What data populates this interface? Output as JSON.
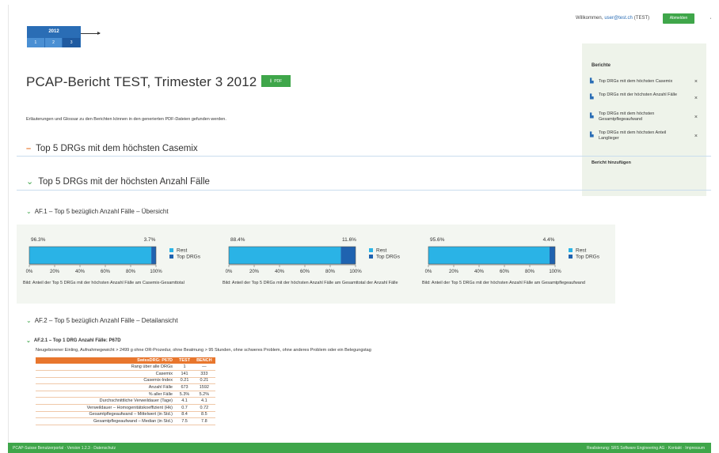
{
  "header": {
    "year": "2012",
    "trimesters": [
      "1",
      "2",
      "3"
    ],
    "welcome_prefix": "Willkommen,",
    "user_email": "user@test.ch",
    "user_suffix": "(TEST)",
    "logout_label": "Abmelden"
  },
  "page": {
    "title": "PCAP-Bericht TEST, Trimester 3 2012",
    "pdf_label": "PDF",
    "intro": "Erläuterungen und Glossar zu den Berichten können in den generierten PDF-Dateien gefunden werden."
  },
  "reports_panel": {
    "title": "Berichte",
    "items": [
      "Top DRGs mit dem höchsten Casemix",
      "Top DRGs mit der höchsten Anzahl Fälle",
      "Top DRGs mit dem höchsten Gesamtpflegeaufwand",
      "Top DRGs mit dem höchsten Anteil Langlieger"
    ],
    "add_label": "Bericht hinzufügen"
  },
  "sections": {
    "s1": "Top 5 DRGs mit dem höchsten Casemix",
    "s2": "Top 5 DRGs mit der höchsten Anzahl Fälle",
    "af1": "AF.1 – Top 5 bezüglich Anzahl Fälle – Übersicht",
    "af2": "AF.2 – Top 5 bezüglich Anzahl Fälle – Detailansicht",
    "af21": "AF.2.1 – Top 1 DRG Anzahl Fälle: P67D",
    "af21_desc": "Neugeborener Einling, Aufnahmegewicht > 2499 g ohne OR-Prozedur, ohne Beatmung > 95 Stunden, ohne schweres Problem, ohne anderes Problem oder ein Belegungstag"
  },
  "chart_data": [
    {
      "type": "bar",
      "orientation": "horizontal-stacked-100",
      "series": [
        {
          "name": "Rest",
          "values": [
            96.3
          ]
        },
        {
          "name": "Top DRGs",
          "values": [
            3.7
          ]
        }
      ],
      "labels": [
        "96.3%",
        "3.7%"
      ],
      "x_ticks": [
        "0%",
        "20%",
        "40%",
        "60%",
        "80%",
        "100%"
      ],
      "xlim": [
        0,
        100
      ],
      "legend": "right",
      "caption": "Bild: Anteil der Top 5 DRGs mit der höchsten Anzahl Fälle am Casemix-Gesamttotal"
    },
    {
      "type": "bar",
      "orientation": "horizontal-stacked-100",
      "series": [
        {
          "name": "Rest",
          "values": [
            88.4
          ]
        },
        {
          "name": "Top DRGs",
          "values": [
            11.6
          ]
        }
      ],
      "labels": [
        "88.4%",
        "11.6%"
      ],
      "x_ticks": [
        "0%",
        "20%",
        "40%",
        "60%",
        "80%",
        "100%"
      ],
      "xlim": [
        0,
        100
      ],
      "legend": "right",
      "caption": "Bild: Anteil der Top 5 DRGs mit der höchsten Anzahl Fälle am Gesamttotal der Anzahl Fälle"
    },
    {
      "type": "bar",
      "orientation": "horizontal-stacked-100",
      "series": [
        {
          "name": "Rest",
          "values": [
            95.6
          ]
        },
        {
          "name": "Top DRGs",
          "values": [
            4.4
          ]
        }
      ],
      "labels": [
        "95.6%",
        "4.4%"
      ],
      "x_ticks": [
        "0%",
        "20%",
        "40%",
        "60%",
        "80%",
        "100%"
      ],
      "xlim": [
        0,
        100
      ],
      "legend": "right",
      "caption": "Bild: Anteil der Top 5 DRGs mit der höchsten Anzahl Fälle am Gesamtpflegeaufwand"
    }
  ],
  "colors": {
    "rest": "#2ab3e6",
    "top": "#1f63b0",
    "accent_green": "#3fa64a",
    "accent_orange": "#e8762d"
  },
  "table": {
    "headers": [
      "SwissDRG: P67D",
      "TEST",
      "BENCH"
    ],
    "rows": [
      [
        "Rang über alle DRGs",
        "1",
        "—"
      ],
      [
        "Casemix",
        "141",
        "333"
      ],
      [
        "Casemix-Index",
        "0.21",
        "0.21"
      ],
      [
        "Anzahl Fälle",
        "673",
        "1592"
      ],
      [
        "% aller Fälle",
        "5.3%",
        "5.2%"
      ],
      [
        "Durchschnittliche Verweildauer (Tage)",
        "4.1",
        "4.1"
      ],
      [
        "Verweildauer – Homogenitätskoeffizient (Hk)",
        "0.7",
        "0.72"
      ],
      [
        "Gesamtpflegeaufwand – Mittelwert (in Std.)",
        "8.4",
        "8.5"
      ],
      [
        "Gesamtpflegeaufwand – Median (in Std.)",
        "7.5",
        "7.8"
      ]
    ]
  },
  "footer": {
    "left": "PCAP-Suisse Benutzerportal · Version 1.2.3 · Datenschutz",
    "right": "Realisierung: SRS Software Engineering AG · Kontakt · Impressum"
  }
}
